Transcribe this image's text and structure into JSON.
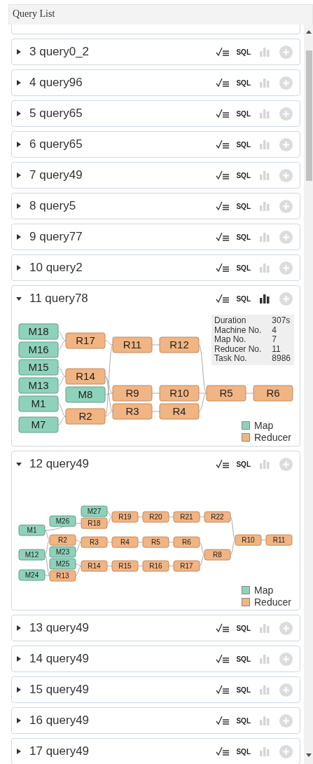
{
  "panel": {
    "title": "Query List"
  },
  "queries": [
    {
      "label": "3 query0_2",
      "expanded": false,
      "chart_enabled": false,
      "sql": "SQL"
    },
    {
      "label": "4 query96",
      "expanded": false,
      "chart_enabled": false,
      "sql": "SQL"
    },
    {
      "label": "5 query65",
      "expanded": false,
      "chart_enabled": false,
      "sql": "SQL"
    },
    {
      "label": "6 query65",
      "expanded": false,
      "chart_enabled": false,
      "sql": "SQL"
    },
    {
      "label": "7 query49",
      "expanded": false,
      "chart_enabled": false,
      "sql": "SQL"
    },
    {
      "label": "8 query5",
      "expanded": false,
      "chart_enabled": false,
      "sql": "SQL"
    },
    {
      "label": "9 query77",
      "expanded": false,
      "chart_enabled": false,
      "sql": "SQL"
    },
    {
      "label": "10 query2",
      "expanded": false,
      "chart_enabled": false,
      "sql": "SQL"
    },
    {
      "label": "11 query78",
      "expanded": true,
      "chart_enabled": true,
      "sql": "SQL",
      "graph": {
        "nodes": [
          {
            "label": "M18",
            "kind": "map"
          },
          {
            "label": "M16",
            "kind": "map"
          },
          {
            "label": "M15",
            "kind": "map"
          },
          {
            "label": "M13",
            "kind": "map"
          },
          {
            "label": "M1",
            "kind": "map"
          },
          {
            "label": "M7",
            "kind": "map"
          },
          {
            "label": "R17",
            "kind": "reducer"
          },
          {
            "label": "R14",
            "kind": "reducer"
          },
          {
            "label": "M8",
            "kind": "map"
          },
          {
            "label": "R2",
            "kind": "reducer"
          },
          {
            "label": "R11",
            "kind": "reducer"
          },
          {
            "label": "R12",
            "kind": "reducer"
          },
          {
            "label": "R9",
            "kind": "reducer"
          },
          {
            "label": "R10",
            "kind": "reducer"
          },
          {
            "label": "R3",
            "kind": "reducer"
          },
          {
            "label": "R4",
            "kind": "reducer"
          },
          {
            "label": "R5",
            "kind": "reducer"
          },
          {
            "label": "R6",
            "kind": "reducer"
          }
        ],
        "stats": [
          {
            "label": "Duration",
            "value": "307s"
          },
          {
            "label": "Machine No.",
            "value": "4"
          },
          {
            "label": "Map No.",
            "value": "7"
          },
          {
            "label": "Reducer No.",
            "value": "11"
          },
          {
            "label": "Task No.",
            "value": "8986"
          }
        ],
        "legend": [
          {
            "label": "Map",
            "kind": "map"
          },
          {
            "label": "Reducer",
            "kind": "reducer"
          }
        ]
      }
    },
    {
      "label": "12 query49",
      "expanded": true,
      "chart_enabled": false,
      "sql": "SQL",
      "graph": {
        "nodes": [
          {
            "label": "M27",
            "kind": "map"
          },
          {
            "label": "M26",
            "kind": "map"
          },
          {
            "label": "R18",
            "kind": "reducer"
          },
          {
            "label": "R19",
            "kind": "reducer"
          },
          {
            "label": "R20",
            "kind": "reducer"
          },
          {
            "label": "R21",
            "kind": "reducer"
          },
          {
            "label": "R22",
            "kind": "reducer"
          },
          {
            "label": "M1",
            "kind": "map"
          },
          {
            "label": "R2",
            "kind": "reducer"
          },
          {
            "label": "R3",
            "kind": "reducer"
          },
          {
            "label": "R4",
            "kind": "reducer"
          },
          {
            "label": "R5",
            "kind": "reducer"
          },
          {
            "label": "R6",
            "kind": "reducer"
          },
          {
            "label": "M12",
            "kind": "map"
          },
          {
            "label": "M23",
            "kind": "map"
          },
          {
            "label": "R8",
            "kind": "reducer"
          },
          {
            "label": "R10",
            "kind": "reducer"
          },
          {
            "label": "R11",
            "kind": "reducer"
          },
          {
            "label": "M25",
            "kind": "map"
          },
          {
            "label": "R14",
            "kind": "reducer"
          },
          {
            "label": "R15",
            "kind": "reducer"
          },
          {
            "label": "R16",
            "kind": "reducer"
          },
          {
            "label": "R17",
            "kind": "reducer"
          },
          {
            "label": "M24",
            "kind": "map"
          },
          {
            "label": "R13",
            "kind": "reducer"
          }
        ],
        "legend": [
          {
            "label": "Map",
            "kind": "map"
          },
          {
            "label": "Reducer",
            "kind": "reducer"
          }
        ]
      }
    },
    {
      "label": "13 query49",
      "expanded": false,
      "chart_enabled": false,
      "sql": "SQL"
    },
    {
      "label": "14 query49",
      "expanded": false,
      "chart_enabled": false,
      "sql": "SQL"
    },
    {
      "label": "15 query49",
      "expanded": false,
      "chart_enabled": false,
      "sql": "SQL"
    },
    {
      "label": "16 query49",
      "expanded": false,
      "chart_enabled": false,
      "sql": "SQL"
    },
    {
      "label": "17 query49",
      "expanded": false,
      "chart_enabled": false,
      "sql": "SQL"
    }
  ]
}
